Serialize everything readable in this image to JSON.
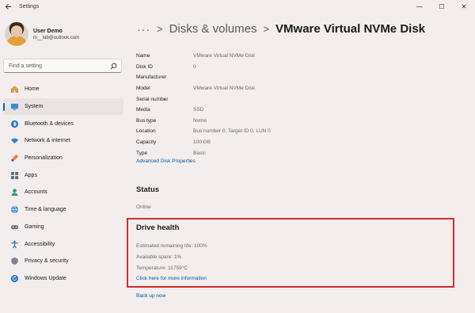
{
  "window": {
    "title": "Settings",
    "controls": {
      "minimize": "—",
      "maximize": "☐",
      "close": "✕"
    }
  },
  "profile": {
    "name": "User Demo",
    "email": "m__lab@outlook.com"
  },
  "search": {
    "placeholder": "Find a setting"
  },
  "nav": {
    "items": [
      {
        "label": "Home",
        "icon": "home-icon"
      },
      {
        "label": "System",
        "icon": "system-icon",
        "selected": true
      },
      {
        "label": "Bluetooth & devices",
        "icon": "bluetooth-icon"
      },
      {
        "label": "Network & internet",
        "icon": "wifi-icon"
      },
      {
        "label": "Personalization",
        "icon": "brush-icon"
      },
      {
        "label": "Apps",
        "icon": "apps-icon"
      },
      {
        "label": "Accounts",
        "icon": "accounts-icon"
      },
      {
        "label": "Time & language",
        "icon": "globe-icon"
      },
      {
        "label": "Gaming",
        "icon": "gamepad-icon"
      },
      {
        "label": "Accessibility",
        "icon": "accessibility-icon"
      },
      {
        "label": "Privacy & security",
        "icon": "shield-icon"
      },
      {
        "label": "Windows Update",
        "icon": "update-icon"
      }
    ]
  },
  "breadcrumb": {
    "more": "···",
    "sep": ">",
    "parent": "Disks & volumes",
    "current": "VMware Virtual NVMe Disk"
  },
  "properties": [
    {
      "label": "Name",
      "value": "VMware Virtual NVMe Disk"
    },
    {
      "label": "Disk ID",
      "value": "0"
    },
    {
      "label": "Manufacturer",
      "value": ""
    },
    {
      "label": "Model",
      "value": "VMware Virtual NVMe Disk"
    },
    {
      "label": "Serial number",
      "value": ""
    },
    {
      "label": "Media",
      "value": "SSD"
    },
    {
      "label": "Bus type",
      "value": "Nvme"
    },
    {
      "label": "Location",
      "value": "Bus number 0, Target ID 0, LUN 0"
    },
    {
      "label": "Capacity",
      "value": "100 GB"
    },
    {
      "label": "Type",
      "value": "Basic"
    }
  ],
  "links": {
    "advanced": "Advanced Disk Properties",
    "more_info": "Click here for more information",
    "backup": "Back up now"
  },
  "status": {
    "heading": "Status",
    "value": "Online"
  },
  "health": {
    "heading": "Drive health",
    "life": "Estimated remaining life: 100%",
    "spare": "Available spare: 1%",
    "temperature": "Temperature: 11759°C"
  },
  "colors": {
    "accent": "#0067c0",
    "highlight_border": "#d22d2d",
    "link": "#0058a3",
    "background": "#f3eded"
  }
}
